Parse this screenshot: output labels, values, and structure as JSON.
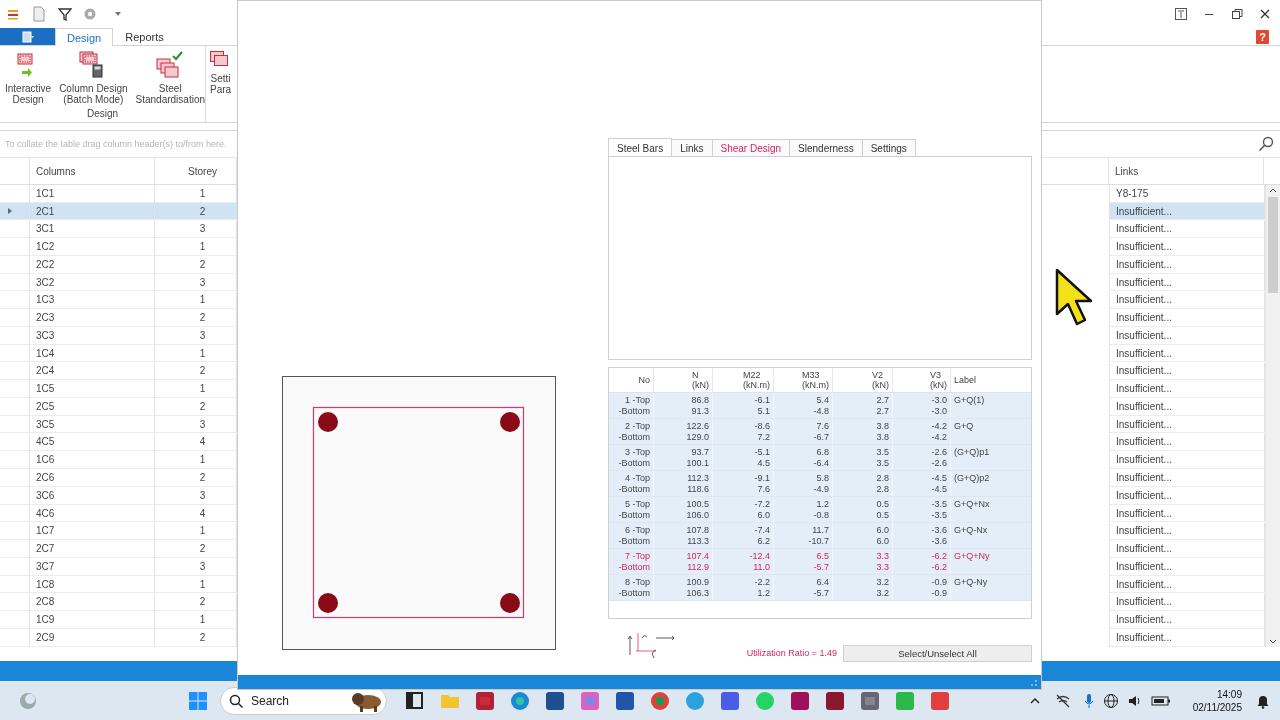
{
  "ribbon": {
    "tabs": [
      {
        "label": "Design",
        "selected": true
      },
      {
        "label": "Reports",
        "selected": false
      }
    ],
    "buttons": [
      {
        "lines": [
          "Interactive",
          "Design"
        ]
      },
      {
        "lines": [
          "Column Design",
          "(Batch Mode)"
        ]
      },
      {
        "lines": [
          "Steel",
          "Standardisation"
        ]
      },
      {
        "lines": [
          "Setti",
          "Para"
        ]
      }
    ],
    "group": "Design",
    "help": "?"
  },
  "grid": {
    "group_hint": "To collate the table drag column header(s) to/from here.",
    "columns": [
      "Columns",
      "Storey",
      "Links"
    ],
    "rows": [
      {
        "cells": [
          "1C1",
          "1",
          "Y8-175"
        ],
        "selected": false
      },
      {
        "cells": [
          "2C1",
          "2",
          "Insufficient..."
        ],
        "selected": true
      },
      {
        "cells": [
          "3C1",
          "3",
          "Insufficient..."
        ],
        "selected": false
      },
      {
        "cells": [
          "1C2",
          "1",
          "Insufficient..."
        ],
        "selected": false
      },
      {
        "cells": [
          "2C2",
          "2",
          "Insufficient..."
        ],
        "selected": false
      },
      {
        "cells": [
          "3C2",
          "3",
          "Insufficient..."
        ],
        "selected": false
      },
      {
        "cells": [
          "1C3",
          "1",
          "Insufficient..."
        ],
        "selected": false
      },
      {
        "cells": [
          "2C3",
          "2",
          "Insufficient..."
        ],
        "selected": false
      },
      {
        "cells": [
          "3C3",
          "3",
          "Insufficient..."
        ],
        "selected": false
      },
      {
        "cells": [
          "1C4",
          "1",
          "Insufficient..."
        ],
        "selected": false
      },
      {
        "cells": [
          "2C4",
          "2",
          "Insufficient..."
        ],
        "selected": false
      },
      {
        "cells": [
          "1C5",
          "1",
          "Insufficient..."
        ],
        "selected": false
      },
      {
        "cells": [
          "2C5",
          "2",
          "Insufficient..."
        ],
        "selected": false
      },
      {
        "cells": [
          "3C5",
          "3",
          "Insufficient..."
        ],
        "selected": false
      },
      {
        "cells": [
          "4C5",
          "4",
          "Insufficient..."
        ],
        "selected": false
      },
      {
        "cells": [
          "1C6",
          "1",
          "Insufficient..."
        ],
        "selected": false
      },
      {
        "cells": [
          "2C6",
          "2",
          "Insufficient..."
        ],
        "selected": false
      },
      {
        "cells": [
          "3C6",
          "3",
          "Insufficient..."
        ],
        "selected": false
      },
      {
        "cells": [
          "4C6",
          "4",
          "Insufficient..."
        ],
        "selected": false
      },
      {
        "cells": [
          "1C7",
          "1",
          "Insufficient..."
        ],
        "selected": false
      },
      {
        "cells": [
          "2C7",
          "2",
          "Insufficient..."
        ],
        "selected": false
      },
      {
        "cells": [
          "3C7",
          "3",
          "Insufficient..."
        ],
        "selected": false
      },
      {
        "cells": [
          "1C8",
          "1",
          "Insufficient..."
        ],
        "selected": false
      },
      {
        "cells": [
          "2C8",
          "2",
          "Insufficient..."
        ],
        "selected": false
      },
      {
        "cells": [
          "1C9",
          "1",
          "Insufficient..."
        ],
        "selected": false
      },
      {
        "cells": [
          "2C9",
          "2",
          "Insufficient..."
        ],
        "selected": false
      }
    ]
  },
  "dialog": {
    "tabs": [
      {
        "label": "Steel Bars",
        "selected": true,
        "warning": false
      },
      {
        "label": "Links",
        "selected": false,
        "warning": false
      },
      {
        "label": "Shear Design",
        "selected": false,
        "warning": true
      },
      {
        "label": "Slenderness",
        "selected": false,
        "warning": false
      },
      {
        "label": "Settings",
        "selected": false,
        "warning": false
      }
    ],
    "loads": {
      "columns": [
        {
          "name": "No"
        },
        {
          "name": "N",
          "unit": "(kN)"
        },
        {
          "name": "M22",
          "unit": "(kN.m)"
        },
        {
          "name": "M33",
          "unit": "(kN.m)"
        },
        {
          "name": "V2",
          "unit": "(kN)"
        },
        {
          "name": "V3",
          "unit": "(kN)"
        },
        {
          "name": "Label"
        }
      ],
      "rows": [
        {
          "no": [
            "1 -Top",
            "-Bottom"
          ],
          "values": [
            [
              "86.8",
              "91.3"
            ],
            [
              "-6.1",
              "5.1"
            ],
            [
              "5.4",
              "-4.8"
            ],
            [
              "2.7",
              "2.7"
            ],
            [
              "-3.0",
              "-3.0"
            ]
          ],
          "label": "G+Q(1)",
          "critical": false,
          "selected": true
        },
        {
          "no": [
            "2 -Top",
            "-Bottom"
          ],
          "values": [
            [
              "122.6",
              "129.0"
            ],
            [
              "-8.6",
              "7.2"
            ],
            [
              "7.6",
              "-6.7"
            ],
            [
              "3.8",
              "3.8"
            ],
            [
              "-4.2",
              "-4.2"
            ]
          ],
          "label": "G+Q",
          "critical": false,
          "selected": true
        },
        {
          "no": [
            "3 -Top",
            "-Bottom"
          ],
          "values": [
            [
              "93.7",
              "100.1"
            ],
            [
              "-5.1",
              "4.5"
            ],
            [
              "6.8",
              "-6.4"
            ],
            [
              "3.5",
              "3.5"
            ],
            [
              "-2.6",
              "-2.6"
            ]
          ],
          "label": "(G+Q)p1",
          "critical": false,
          "selected": true
        },
        {
          "no": [
            "4 -Top",
            "-Bottom"
          ],
          "values": [
            [
              "112.3",
              "118.6"
            ],
            [
              "-9.1",
              "7.6"
            ],
            [
              "5.8",
              "-4.9"
            ],
            [
              "2.8",
              "2.8"
            ],
            [
              "-4.5",
              "-4.5"
            ]
          ],
          "label": "(G+Q)p2",
          "critical": false,
          "selected": true
        },
        {
          "no": [
            "5 -Top",
            "-Bottom"
          ],
          "values": [
            [
              "100.5",
              "106.0"
            ],
            [
              "-7.2",
              "6.0"
            ],
            [
              "1.2",
              "-0.8"
            ],
            [
              "0.5",
              "0.5"
            ],
            [
              "-3.5",
              "-3.5"
            ]
          ],
          "label": "G+Q+Nx",
          "critical": false,
          "selected": true
        },
        {
          "no": [
            "6 -Top",
            "-Bottom"
          ],
          "values": [
            [
              "107.8",
              "113.3"
            ],
            [
              "-7.4",
              "6.2"
            ],
            [
              "11.7",
              "-10.7"
            ],
            [
              "6.0",
              "6.0"
            ],
            [
              "-3.6",
              "-3.6"
            ]
          ],
          "label": "G+Q-Nx",
          "critical": false,
          "selected": true
        },
        {
          "no": [
            "7 -Top",
            "-Bottom"
          ],
          "values": [
            [
              "107.4",
              "112.9"
            ],
            [
              "-12.4",
              "11.0"
            ],
            [
              "6.5",
              "-5.7"
            ],
            [
              "3.3",
              "3.3"
            ],
            [
              "-6.2",
              "-6.2"
            ]
          ],
          "label": "G+Q+Ny",
          "critical": true,
          "selected": true
        },
        {
          "no": [
            "8 -Top",
            "-Bottom"
          ],
          "values": [
            [
              "100.9",
              "106.3"
            ],
            [
              "-2.2",
              "1.2"
            ],
            [
              "6.4",
              "-5.7"
            ],
            [
              "3.2",
              "3.2"
            ],
            [
              "-0.9",
              "-0.9"
            ]
          ],
          "label": "G+Q-Ny",
          "critical": false,
          "selected": true
        }
      ]
    },
    "ratio": "Utilization Ratio = 1.49",
    "select_all": "Select/Unselect All"
  },
  "taskbar": {
    "search": "Search",
    "time": "14:09",
    "date": "02/11/2025"
  }
}
